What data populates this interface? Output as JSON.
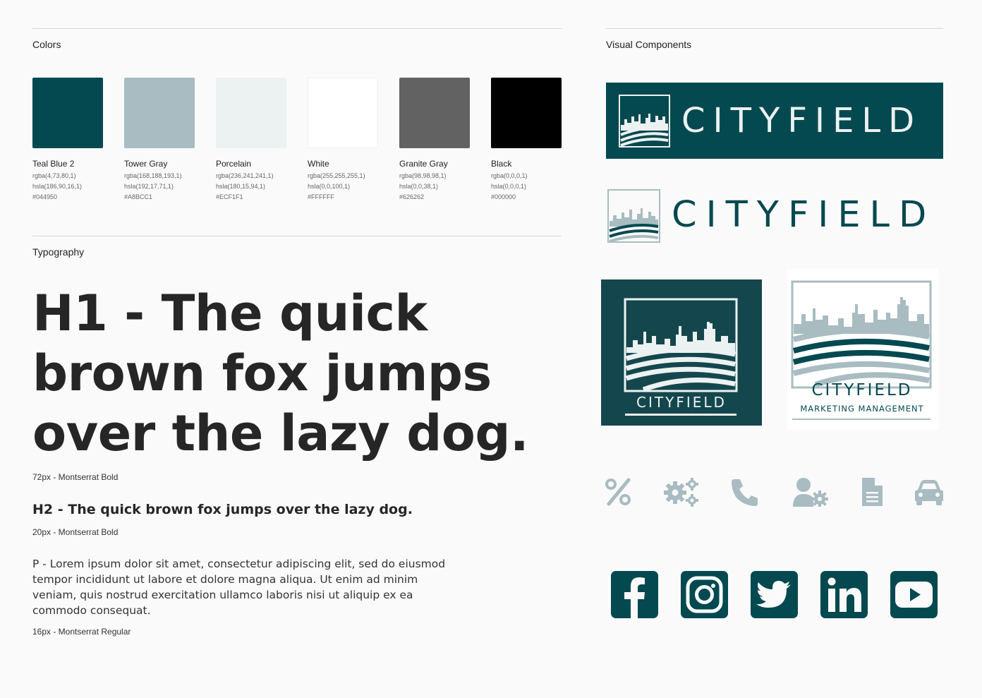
{
  "sections": {
    "colors": "Colors",
    "typography": "Typography",
    "visual_components": "Visual Components"
  },
  "colors": [
    {
      "name": "Teal Blue 2",
      "rgba": "rgba(4,73,80,1)",
      "hsla": "hsla(186,90,16,1)",
      "hex": "#044950"
    },
    {
      "name": "Tower Gray",
      "rgba": "rgba(168,188,193,1)",
      "hsla": "hsla(192,17,71,1)",
      "hex": "#A8BCC1"
    },
    {
      "name": "Porcelain",
      "rgba": "rgba(236,241,241,1)",
      "hsla": "hsla(180,15,94,1)",
      "hex": "#ECF1F1"
    },
    {
      "name": "White",
      "rgba": "rgba(255,255,255,1)",
      "hsla": "hsla(0,0,100,1)",
      "hex": "#FFFFFF"
    },
    {
      "name": "Granite Gray",
      "rgba": "rgba(98,98,98,1)",
      "hsla": "hsla(0,0,38,1)",
      "hex": "#626262"
    },
    {
      "name": "Black",
      "rgba": "rgba(0,0,0,1)",
      "hsla": "hsla(0,0,0,1)",
      "hex": "#000000"
    }
  ],
  "typography": {
    "h1_sample": "H1 - The quick brown fox jumps over the lazy dog.",
    "h1_caption": "72px - Montserrat Bold",
    "h2_sample": "H2 - The quick brown fox jumps over the lazy dog.",
    "h2_caption": "20px - Montserrat Bold",
    "p_sample": "P - Lorem ipsum dolor sit amet, consectetur adipiscing elit, sed do eiusmod tempor incididunt ut labore et dolore magna aliqua. Ut enim ad minim veniam, quis nostrud exercitation ullamco laboris nisi ut aliquip ex ea commodo consequat.",
    "p_caption": "16px - Montserrat Regular"
  },
  "logos": {
    "wordmark": "CITYFIELD",
    "tagline": "MARKETING MANAGEMENT"
  },
  "feature_icons": [
    "percent-icon",
    "gears-icon",
    "phone-icon",
    "user-gear-icon",
    "document-icon",
    "car-icon"
  ],
  "social_icons": [
    "facebook-icon",
    "instagram-icon",
    "twitter-icon",
    "linkedin-icon",
    "youtube-icon"
  ]
}
